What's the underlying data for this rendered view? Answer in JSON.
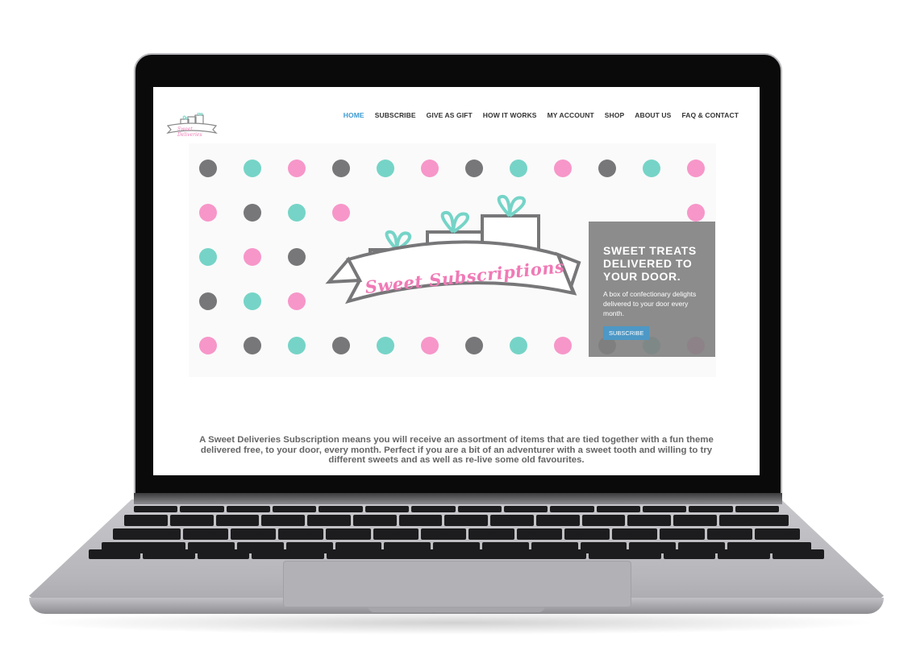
{
  "site": {
    "logo_text": "Sweet Deliveries",
    "nav": [
      {
        "label": "HOME",
        "active": true
      },
      {
        "label": "SUBSCRIBE",
        "active": false
      },
      {
        "label": "GIVE AS GIFT",
        "active": false
      },
      {
        "label": "HOW IT WORKS",
        "active": false
      },
      {
        "label": "MY ACCOUNT",
        "active": false
      },
      {
        "label": "SHOP",
        "active": false
      },
      {
        "label": "ABOUT US",
        "active": false
      },
      {
        "label": "FAQ & CONTACT",
        "active": false
      }
    ],
    "hero": {
      "banner_text": "Sweet Subscriptions",
      "callout_title": "SWEET TREATS DELIVERED TO YOUR DOOR.",
      "callout_body": "A box of confectionary delights delivered to your door every month.",
      "callout_button": "SUBSCRIBE",
      "slides_total": 4,
      "slide_active": 1
    },
    "intro_text": "A Sweet Deliveries Subscription means you will receive an assortment of items that are tied together with a fun theme delivered free, to your door, every month. Perfect if you are a bit of an adventurer with a sweet tooth and willing to try different sweets and as well as re-live some old favourites."
  },
  "colors": {
    "accent": "#3e9ad1",
    "pink": "#f796c9",
    "teal": "#75d4c7",
    "grey": "#777779",
    "button": "#4d98c6"
  }
}
